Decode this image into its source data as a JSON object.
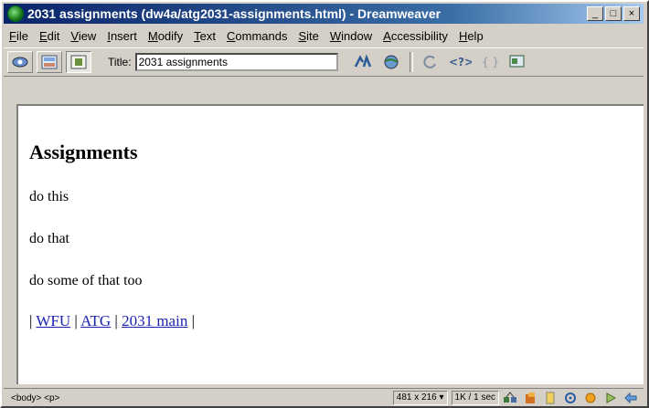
{
  "window": {
    "title": "2031 assignments (dw4a/atg2031-assignments.html) - Dreamweaver",
    "buttons": [
      "_",
      "□",
      "×"
    ]
  },
  "menu": [
    {
      "first": "F",
      "rest": "ile"
    },
    {
      "first": "E",
      "rest": "dit"
    },
    {
      "first": "V",
      "rest": "iew"
    },
    {
      "first": "I",
      "rest": "nsert"
    },
    {
      "first": "M",
      "rest": "odify"
    },
    {
      "first": "T",
      "rest": "ext"
    },
    {
      "first": "C",
      "rest": "ommands"
    },
    {
      "first": "S",
      "rest": "ite"
    },
    {
      "first": "W",
      "rest": "indow"
    },
    {
      "first": "A",
      "rest": "ccessibility"
    },
    {
      "first": "H",
      "rest": "elp"
    }
  ],
  "toolbar": {
    "title_label": "Title:",
    "title_value": "2031 assignments",
    "icons": [
      "code-view-icon",
      "split-view-icon",
      "design-view-icon",
      "file-management-icon",
      "preview-globe-icon",
      "refresh-icon",
      "view-options-icon",
      "code-braces-icon",
      "visual-aids-icon"
    ]
  },
  "document": {
    "heading": "Assignments",
    "paragraphs": [
      "do this",
      "do that",
      "do some of that too"
    ],
    "links": [
      "WFU",
      "ATG",
      "2031 main"
    ],
    "separator": "|"
  },
  "status": {
    "tags": "<body> <p>",
    "window_size": "481 x 216 ▾",
    "download": "1K / 1 sec"
  }
}
